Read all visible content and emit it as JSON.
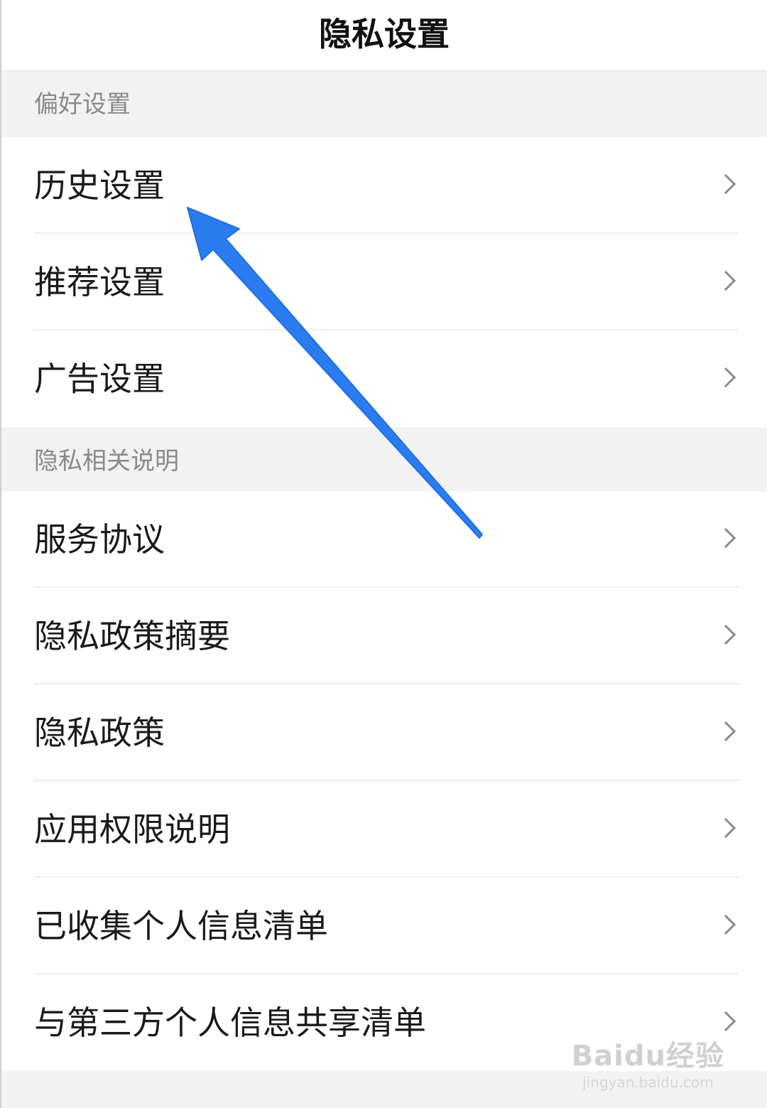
{
  "header": {
    "title": "隐私设置"
  },
  "sections": [
    {
      "label": "偏好设置",
      "items": [
        {
          "label": "历史设置"
        },
        {
          "label": "推荐设置"
        },
        {
          "label": "广告设置"
        }
      ]
    },
    {
      "label": "隐私相关说明",
      "items": [
        {
          "label": "服务协议"
        },
        {
          "label": "隐私政策摘要"
        },
        {
          "label": "隐私政策"
        },
        {
          "label": "应用权限说明"
        },
        {
          "label": "已收集个人信息清单"
        },
        {
          "label": "与第三方个人信息共享清单"
        }
      ]
    }
  ],
  "watermark": {
    "logo": "Baidu经验",
    "url": "jingyan.baidu.com"
  },
  "colors": {
    "annotation_arrow": "#2b7cf0",
    "background": "#f2f2f2",
    "row_background": "#ffffff"
  },
  "icons": {
    "row_chevron": "chevron-right-icon",
    "annotation": "arrow-annotation-icon"
  }
}
